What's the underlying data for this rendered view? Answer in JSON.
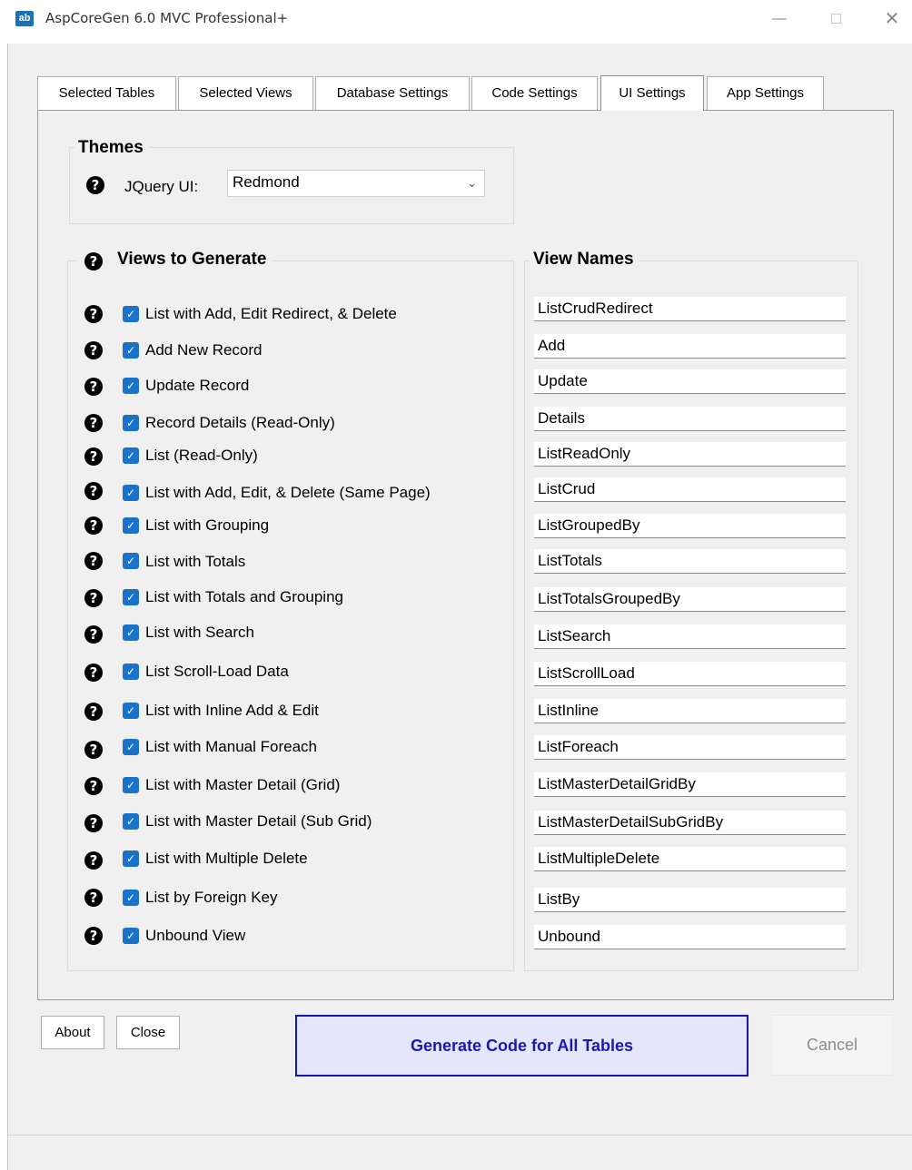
{
  "window": {
    "title": "AspCoreGen 6.0 MVC Professional+",
    "icon_text": "ab",
    "minimize": "—",
    "close": "✕"
  },
  "tabs": [
    {
      "label": "Selected Tables"
    },
    {
      "label": "Selected Views"
    },
    {
      "label": "Database Settings"
    },
    {
      "label": "Code Settings"
    },
    {
      "label": "UI Settings",
      "active": true
    },
    {
      "label": "App Settings"
    }
  ],
  "themes": {
    "title": "Themes",
    "jquery_label": "JQuery UI:",
    "jquery_value": "Redmond"
  },
  "views": {
    "title": "Views to Generate",
    "names_title": "View Names",
    "items": [
      {
        "label": "List with Add, Edit Redirect, & Delete",
        "checked": true,
        "name": "ListCrudRedirect"
      },
      {
        "label": "Add New Record",
        "checked": true,
        "name": "Add"
      },
      {
        "label": "Update Record",
        "checked": true,
        "name": "Update"
      },
      {
        "label": "Record Details (Read-Only)",
        "checked": true,
        "name": "Details"
      },
      {
        "label": "List (Read-Only)",
        "checked": true,
        "name": "ListReadOnly"
      },
      {
        "label": "List with Add, Edit, & Delete (Same Page)",
        "checked": true,
        "name": "ListCrud"
      },
      {
        "label": "List with Grouping",
        "checked": true,
        "name": "ListGroupedBy"
      },
      {
        "label": "List with Totals",
        "checked": true,
        "name": "ListTotals"
      },
      {
        "label": "List with Totals and Grouping",
        "checked": true,
        "name": "ListTotalsGroupedBy"
      },
      {
        "label": "List with Search",
        "checked": true,
        "name": "ListSearch"
      },
      {
        "label": "List Scroll-Load Data",
        "checked": true,
        "name": "ListScrollLoad"
      },
      {
        "label": "List with Inline Add & Edit",
        "checked": true,
        "name": "ListInline"
      },
      {
        "label": "List with Manual Foreach",
        "checked": true,
        "name": "ListForeach"
      },
      {
        "label": "List with Master Detail (Grid)",
        "checked": true,
        "name": "ListMasterDetailGridBy"
      },
      {
        "label": "List with Master Detail (Sub Grid)",
        "checked": true,
        "name": "ListMasterDetailSubGridBy"
      },
      {
        "label": "List with Multiple Delete",
        "checked": true,
        "name": "ListMultipleDelete"
      },
      {
        "label": "List by Foreign Key",
        "checked": true,
        "name": "ListBy"
      },
      {
        "label": "Unbound View",
        "checked": true,
        "name": "Unbound"
      }
    ]
  },
  "buttons": {
    "about": "About",
    "close": "Close",
    "generate": "Generate Code for All Tables",
    "cancel": "Cancel"
  },
  "colors": {
    "checkbox": "#1a73c9",
    "generate_border": "#1515b4",
    "generate_bg": "#e5e5fb"
  }
}
